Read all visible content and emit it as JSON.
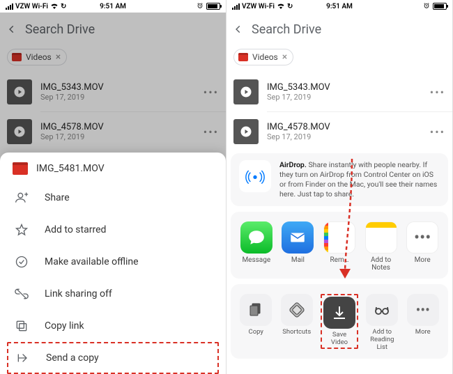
{
  "status": {
    "carrier": "VZW Wi-Fi",
    "time": "9:51 AM"
  },
  "search": {
    "placeholder": "Search Drive"
  },
  "chip": {
    "label": "Videos"
  },
  "files": [
    {
      "name": "IMG_5343.MOV",
      "date": "Sep 17, 2019"
    },
    {
      "name": "IMG_4578.MOV",
      "date": "Sep 17, 2019"
    }
  ],
  "sheet": {
    "title": "IMG_5481.MOV",
    "share": "Share",
    "starred": "Add to starred",
    "offline": "Make available offline",
    "linksharing": "Link sharing off",
    "copylink": "Copy link",
    "sendcopy": "Send a copy"
  },
  "sharesheet": {
    "airdrop_bold": "AirDrop.",
    "airdrop_text": "Share instantly with people nearby. If they turn on AirDrop from Control Center on iOS or from Finder on the Mac, you'll see their names here. Just tap to share.",
    "apps": {
      "message": "Message",
      "mail": "Mail",
      "reminders": "Rem…",
      "notes": "Add to Notes",
      "more": "More"
    },
    "actions": {
      "copy": "Copy",
      "shortcuts": "Shortcuts",
      "savevideo": "Save Video",
      "readinglist": "Add to\nReading List",
      "more": "More"
    }
  }
}
